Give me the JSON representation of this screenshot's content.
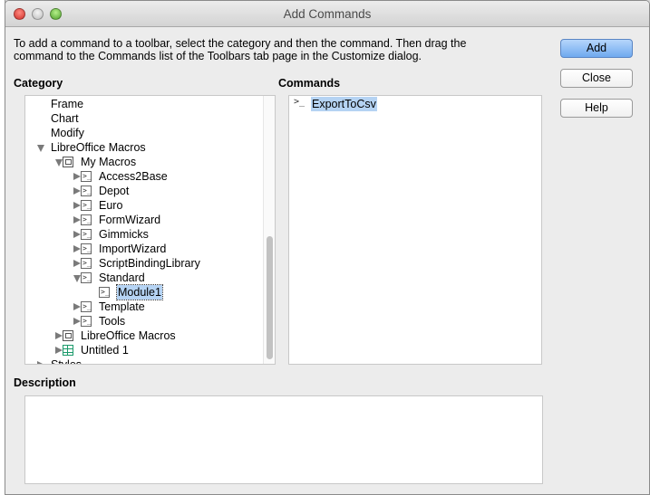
{
  "window": {
    "title": "Add Commands"
  },
  "intro": "To add a command to a toolbar, select the category and then the command. Then drag the command to the Commands list of the Toolbars tab page in the Customize dialog.",
  "category": {
    "label": "Category",
    "items": [
      {
        "label": "Frame",
        "level": 0,
        "expander": "none",
        "icon": "none"
      },
      {
        "label": "Chart",
        "level": 0,
        "expander": "none",
        "icon": "none"
      },
      {
        "label": "Modify",
        "level": 0,
        "expander": "none",
        "icon": "none"
      },
      {
        "label": "LibreOffice Macros",
        "level": 0,
        "expander": "expanded",
        "icon": "none"
      },
      {
        "label": "My Macros",
        "level": 1,
        "expander": "expanded",
        "icon": "computer-icon"
      },
      {
        "label": "Access2Base",
        "level": 2,
        "expander": "collapsed",
        "icon": "macro-icon"
      },
      {
        "label": "Depot",
        "level": 2,
        "expander": "collapsed",
        "icon": "macro-icon"
      },
      {
        "label": "Euro",
        "level": 2,
        "expander": "collapsed",
        "icon": "macro-icon"
      },
      {
        "label": "FormWizard",
        "level": 2,
        "expander": "collapsed",
        "icon": "macro-icon"
      },
      {
        "label": "Gimmicks",
        "level": 2,
        "expander": "collapsed",
        "icon": "macro-icon"
      },
      {
        "label": "ImportWizard",
        "level": 2,
        "expander": "collapsed",
        "icon": "macro-icon"
      },
      {
        "label": "ScriptBindingLibrary",
        "level": 2,
        "expander": "collapsed",
        "icon": "macro-icon"
      },
      {
        "label": "Standard",
        "level": 2,
        "expander": "expanded",
        "icon": "macro-icon"
      },
      {
        "label": "Module1",
        "level": 3,
        "expander": "none",
        "icon": "macro-icon",
        "selected": true
      },
      {
        "label": "Template",
        "level": 2,
        "expander": "collapsed",
        "icon": "macro-icon"
      },
      {
        "label": "Tools",
        "level": 2,
        "expander": "collapsed",
        "icon": "macro-icon"
      },
      {
        "label": "LibreOffice Macros",
        "level": 1,
        "expander": "collapsed",
        "icon": "computer-icon"
      },
      {
        "label": "Untitled 1",
        "level": 1,
        "expander": "collapsed",
        "icon": "spreadsheet-icon"
      },
      {
        "label": "Styles",
        "level": 0,
        "expander": "collapsed",
        "icon": "none"
      }
    ]
  },
  "commands": {
    "label": "Commands",
    "items": [
      {
        "label": "ExportToCsv",
        "icon": "macro-icon",
        "selected": true
      }
    ]
  },
  "description": {
    "label": "Description",
    "text": ""
  },
  "buttons": {
    "add": "Add",
    "close": "Close",
    "help": "Help"
  },
  "colors": {
    "selection": "#b5d3f3",
    "default_button": "#6fa9ef"
  }
}
